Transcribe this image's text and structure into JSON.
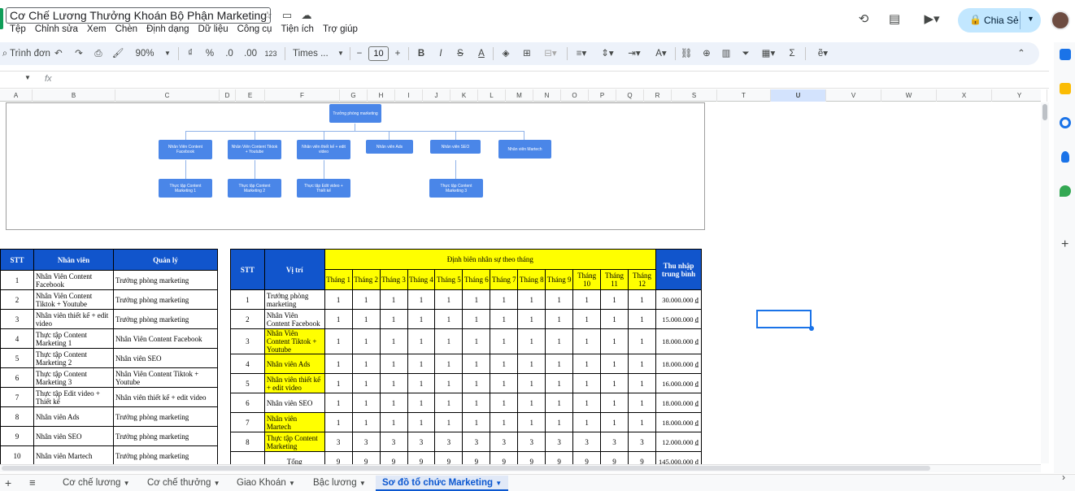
{
  "title": "Cơ Chế Lương Thưởng Khoán Bộ Phận Marketing",
  "menu": [
    "Tệp",
    "Chỉnh sửa",
    "Xem",
    "Chèn",
    "Định dạng",
    "Dữ liệu",
    "Công cụ",
    "Tiện ích",
    "Trợ giúp"
  ],
  "share_label": "Chia Sẻ",
  "toolbar": {
    "search": "Trình đơn",
    "zoom": "90%",
    "currency": "₫",
    "percent": "%",
    "dec_less": ".0",
    "dec_more": ".00",
    "number_fmt": "123",
    "font": "Times ...",
    "font_size": "10"
  },
  "formula_fx": "fx",
  "columns": [
    "A",
    "B",
    "C",
    "D",
    "E",
    "F",
    "G",
    "H",
    "I",
    "J",
    "K",
    "L",
    "M",
    "N",
    "O",
    "P",
    "Q",
    "R",
    "S",
    "T",
    "U",
    "V",
    "W",
    "X",
    "Y"
  ],
  "org": {
    "root": "Trưởng phòng marketing",
    "level2": [
      "Nhân Viên Content Facebook",
      "Nhân Viên Content Tiktok + Youtube",
      "Nhân viên thiết kế + edit video",
      "Nhân viên Ads",
      "Nhân viên SEO",
      "Nhân viên Martech"
    ],
    "level3": [
      "Thực tập Content Marketing 1",
      "Thực tập Content Marketing 2",
      "Thực tập Edit video + Thiết kế",
      "Thực tập Content Marketing 3"
    ]
  },
  "table1": {
    "headers": [
      "STT",
      "Nhân viên",
      "Quản lý"
    ],
    "rows": [
      [
        "1",
        "Nhân Viên Content Facebook",
        "Trưởng phòng marketing"
      ],
      [
        "2",
        "Nhân Viên Content Tiktok + Youtube",
        "Trưởng phòng marketing"
      ],
      [
        "3",
        "Nhân viên thiết kế + edit video",
        "Trưởng phòng marketing"
      ],
      [
        "4",
        "Thực tập Content Marketing 1",
        "Nhân Viên Content Facebook"
      ],
      [
        "5",
        "Thực tập Content Marketing 2",
        "Nhân viên SEO"
      ],
      [
        "6",
        "Thực tập Content Marketing 3",
        "Nhân Viên Content Tiktok + Youtube"
      ],
      [
        "7",
        "Thực tập Edit video + Thiết kế",
        "Nhân viên thiết kế + edit video"
      ],
      [
        "8",
        "Nhân viên Ads",
        "Trưởng phòng marketing"
      ],
      [
        "9",
        "Nhân viên SEO",
        "Trưởng phòng marketing"
      ],
      [
        "10",
        "Nhân viên Martech",
        "Trưởng phòng marketing"
      ]
    ]
  },
  "table2": {
    "h_stt": "STT",
    "h_pos": "Vị trí",
    "h_group": "Định biên nhân sự theo tháng",
    "h_income": "Thu nhập trung bình",
    "months": [
      "Tháng 1",
      "Tháng 2",
      "Tháng 3",
      "Tháng 4",
      "Tháng 5",
      "Tháng 6",
      "Tháng 7",
      "Tháng 8",
      "Tháng 9",
      "Tháng 10",
      "Tháng 11",
      "Tháng 12"
    ],
    "rows": [
      {
        "stt": "1",
        "pos": "Trưởng phòng marketing",
        "hl": false,
        "vals": [
          "1",
          "1",
          "1",
          "1",
          "1",
          "1",
          "1",
          "1",
          "1",
          "1",
          "1",
          "1"
        ],
        "income": "30.000.000 ₫"
      },
      {
        "stt": "2",
        "pos": "Nhân Viên Content Facebook",
        "hl": false,
        "vals": [
          "1",
          "1",
          "1",
          "1",
          "1",
          "1",
          "1",
          "1",
          "1",
          "1",
          "1",
          "1"
        ],
        "income": "15.000.000 ₫"
      },
      {
        "stt": "3",
        "pos": "Nhân Viên Content Tiktok + Youtube",
        "hl": true,
        "vals": [
          "1",
          "1",
          "1",
          "1",
          "1",
          "1",
          "1",
          "1",
          "1",
          "1",
          "1",
          "1"
        ],
        "income": "18.000.000 ₫"
      },
      {
        "stt": "4",
        "pos": "Nhân viên Ads",
        "hl": true,
        "vals": [
          "1",
          "1",
          "1",
          "1",
          "1",
          "1",
          "1",
          "1",
          "1",
          "1",
          "1",
          "1"
        ],
        "income": "18.000.000 ₫"
      },
      {
        "stt": "5",
        "pos": "Nhân viên thiết kế + edit video",
        "hl": true,
        "vals": [
          "1",
          "1",
          "1",
          "1",
          "1",
          "1",
          "1",
          "1",
          "1",
          "1",
          "1",
          "1"
        ],
        "income": "16.000.000 ₫"
      },
      {
        "stt": "6",
        "pos": "Nhân viên SEO",
        "hl": false,
        "vals": [
          "1",
          "1",
          "1",
          "1",
          "1",
          "1",
          "1",
          "1",
          "1",
          "1",
          "1",
          "1"
        ],
        "income": "18.000.000 ₫"
      },
      {
        "stt": "7",
        "pos": "Nhân viên Martech",
        "hl": true,
        "vals": [
          "1",
          "1",
          "1",
          "1",
          "1",
          "1",
          "1",
          "1",
          "1",
          "1",
          "1",
          "1"
        ],
        "income": "18.000.000 ₫"
      },
      {
        "stt": "8",
        "pos": "Thực tập Content Marketing",
        "hl": true,
        "vals": [
          "3",
          "3",
          "3",
          "3",
          "3",
          "3",
          "3",
          "3",
          "3",
          "3",
          "3",
          "3"
        ],
        "income": "12.000.000 ₫"
      }
    ],
    "total_label": "Tổng",
    "total_vals": [
      "9",
      "9",
      "9",
      "9",
      "9",
      "9",
      "9",
      "9",
      "9",
      "9",
      "9",
      "9"
    ],
    "total_income": "145.000.000 ₫"
  },
  "sheets": [
    "Cơ chế lương",
    "Cơ chế thưởng",
    "Giao Khoán",
    "Bậc lương",
    "Sơ đồ tổ chức Marketing"
  ],
  "active_sheet": "Sơ đồ tổ chức Marketing",
  "colors": {
    "header_blue": "#1155cc",
    "highlight": "#ffff00",
    "node": "#4a86e8",
    "accent": "#0b57d0"
  }
}
